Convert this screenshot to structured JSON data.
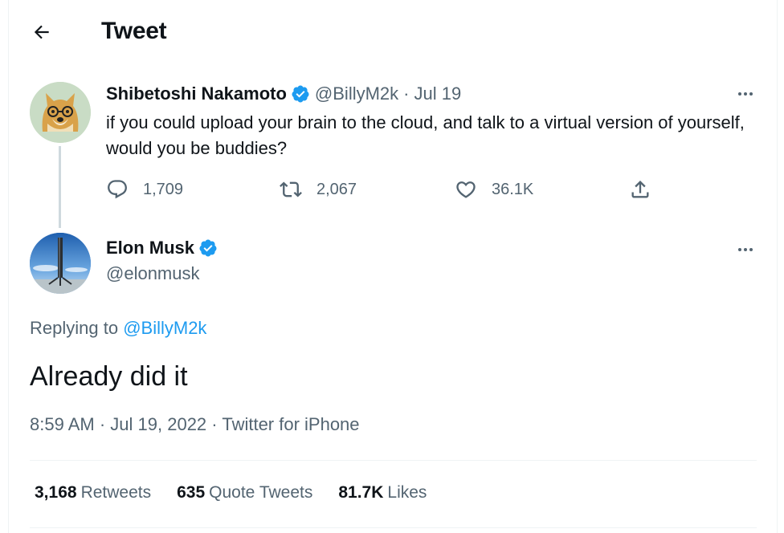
{
  "header": {
    "title": "Tweet"
  },
  "parent_tweet": {
    "author_name": "Shibetoshi Nakamoto",
    "handle": "@BillyM2k",
    "separator": "·",
    "date": "Jul 19",
    "text": "if you could upload your brain to the cloud, and talk to a virtual version of yourself, would you be buddies?",
    "replies": "1,709",
    "retweets": "2,067",
    "likes": "36.1K"
  },
  "main_tweet": {
    "author_name": "Elon Musk",
    "handle": "@elonmusk",
    "replying_prefix": "Replying to",
    "replying_handle": "@BillyM2k",
    "text": "Already did it",
    "time": "8:59 AM",
    "separator": "·",
    "date": "Jul 19, 2022",
    "separator2": "·",
    "source": "Twitter for iPhone"
  },
  "stats": {
    "retweets_count": "3,168",
    "retweets_label": "Retweets",
    "quotes_count": "635",
    "quotes_label": "Quote Tweets",
    "likes_count": "81.7K",
    "likes_label": "Likes"
  },
  "colors": {
    "accent": "#1d9bf0",
    "text": "#0f1419",
    "secondary": "#536471",
    "divider": "#eff3f4"
  },
  "icons": [
    "back-arrow-icon",
    "verified-badge-icon",
    "more-icon",
    "reply-icon",
    "retweet-icon",
    "like-icon",
    "share-icon"
  ]
}
